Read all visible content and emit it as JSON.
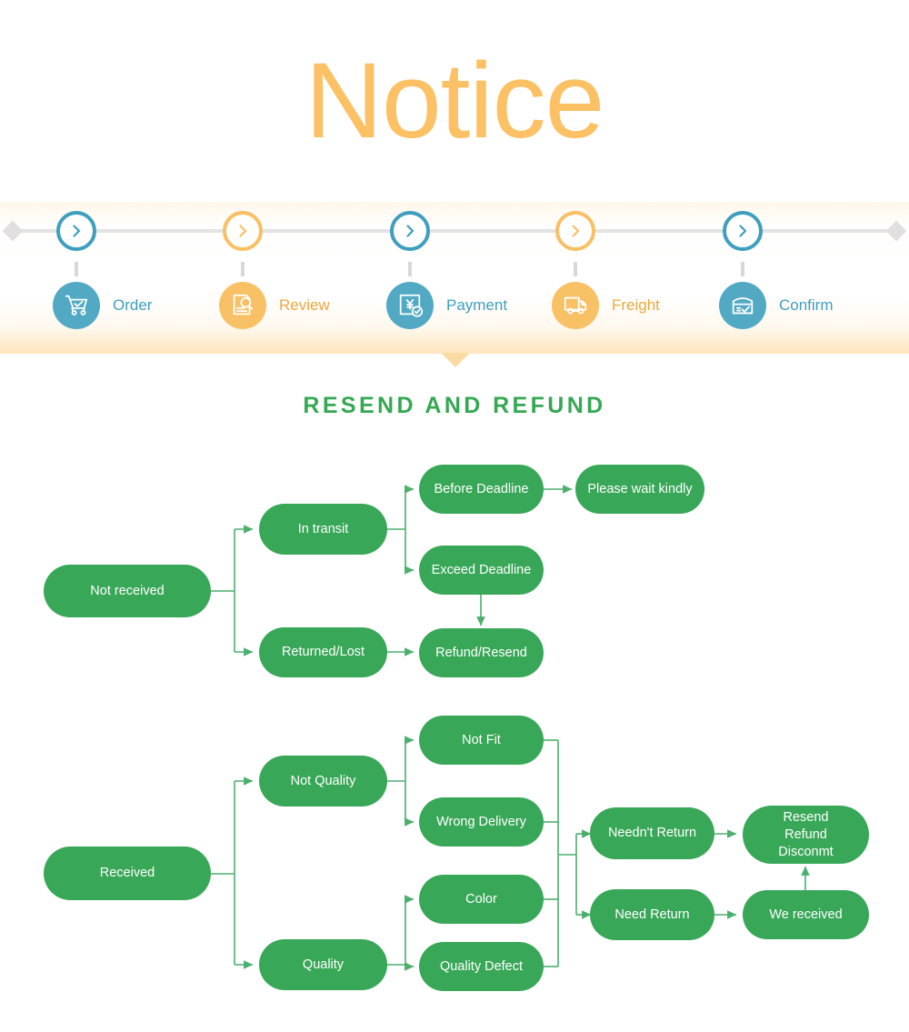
{
  "header": {
    "title": "Notice"
  },
  "steps": {
    "items": [
      {
        "label": "Order",
        "icon": "shopping-cart-icon",
        "color": "blue"
      },
      {
        "label": "Review",
        "icon": "document-search-icon",
        "color": "orange"
      },
      {
        "label": "Payment",
        "icon": "invoice-yen-check-icon",
        "color": "blue"
      },
      {
        "label": "Freight",
        "icon": "delivery-truck-icon",
        "color": "orange"
      },
      {
        "label": "Confirm",
        "icon": "package-check-icon",
        "color": "blue"
      }
    ],
    "node_icon": "chevron-right-circle-icon"
  },
  "section": {
    "heading": "RESEND AND REFUND"
  },
  "colors": {
    "title_orange": "#fbc164",
    "step_blue": "#51a9c4",
    "step_orange": "#f9c166",
    "heading_green": "#34a853",
    "node_green": "#39a758",
    "connector_green": "#4caf6d",
    "track_gray": "#e3e3e3"
  },
  "flow_not_received": {
    "nodes": [
      {
        "id": "not-received",
        "label": "Not received"
      },
      {
        "id": "in-transit",
        "label": "In transit"
      },
      {
        "id": "returned-lost",
        "label": "Returned/Lost"
      },
      {
        "id": "before-deadline",
        "label": "Before Deadline"
      },
      {
        "id": "exceed-deadline",
        "label": "Exceed Deadline"
      },
      {
        "id": "please-wait",
        "label": "Please wait kindly"
      },
      {
        "id": "refund-resend",
        "label": "Refund/Resend"
      }
    ],
    "edges": [
      {
        "from": "not-received",
        "to": "in-transit"
      },
      {
        "from": "not-received",
        "to": "returned-lost"
      },
      {
        "from": "in-transit",
        "to": "before-deadline"
      },
      {
        "from": "in-transit",
        "to": "exceed-deadline"
      },
      {
        "from": "before-deadline",
        "to": "please-wait"
      },
      {
        "from": "exceed-deadline",
        "to": "refund-resend"
      },
      {
        "from": "returned-lost",
        "to": "refund-resend"
      }
    ]
  },
  "flow_received": {
    "nodes": [
      {
        "id": "received",
        "label": "Received"
      },
      {
        "id": "not-quality",
        "label": "Not Quality"
      },
      {
        "id": "quality",
        "label": "Quality"
      },
      {
        "id": "not-fit",
        "label": "Not Fit"
      },
      {
        "id": "wrong-delivery",
        "label": "Wrong Delivery"
      },
      {
        "id": "color",
        "label": "Color"
      },
      {
        "id": "quality-defect",
        "label": "Quality Defect"
      },
      {
        "id": "neednt-return",
        "label": "Needn't Return"
      },
      {
        "id": "need-return",
        "label": "Need Return"
      },
      {
        "id": "resend-refund-disconmt",
        "label": "Resend\nRefund\nDisconmt"
      },
      {
        "id": "we-received",
        "label": "We received"
      }
    ],
    "edges": [
      {
        "from": "received",
        "to": "not-quality"
      },
      {
        "from": "received",
        "to": "quality"
      },
      {
        "from": "not-quality",
        "to": "not-fit"
      },
      {
        "from": "not-quality",
        "to": "wrong-delivery"
      },
      {
        "from": "quality",
        "to": "color"
      },
      {
        "from": "quality",
        "to": "quality-defect"
      },
      {
        "from": "not-fit",
        "to": "neednt-return"
      },
      {
        "from": "wrong-delivery",
        "to": "neednt-return"
      },
      {
        "from": "color",
        "to": "need-return"
      },
      {
        "from": "quality-defect",
        "to": "need-return"
      },
      {
        "from": "neednt-return",
        "to": "resend-refund-disconmt"
      },
      {
        "from": "need-return",
        "to": "we-received"
      },
      {
        "from": "we-received",
        "to": "resend-refund-disconmt"
      }
    ]
  }
}
